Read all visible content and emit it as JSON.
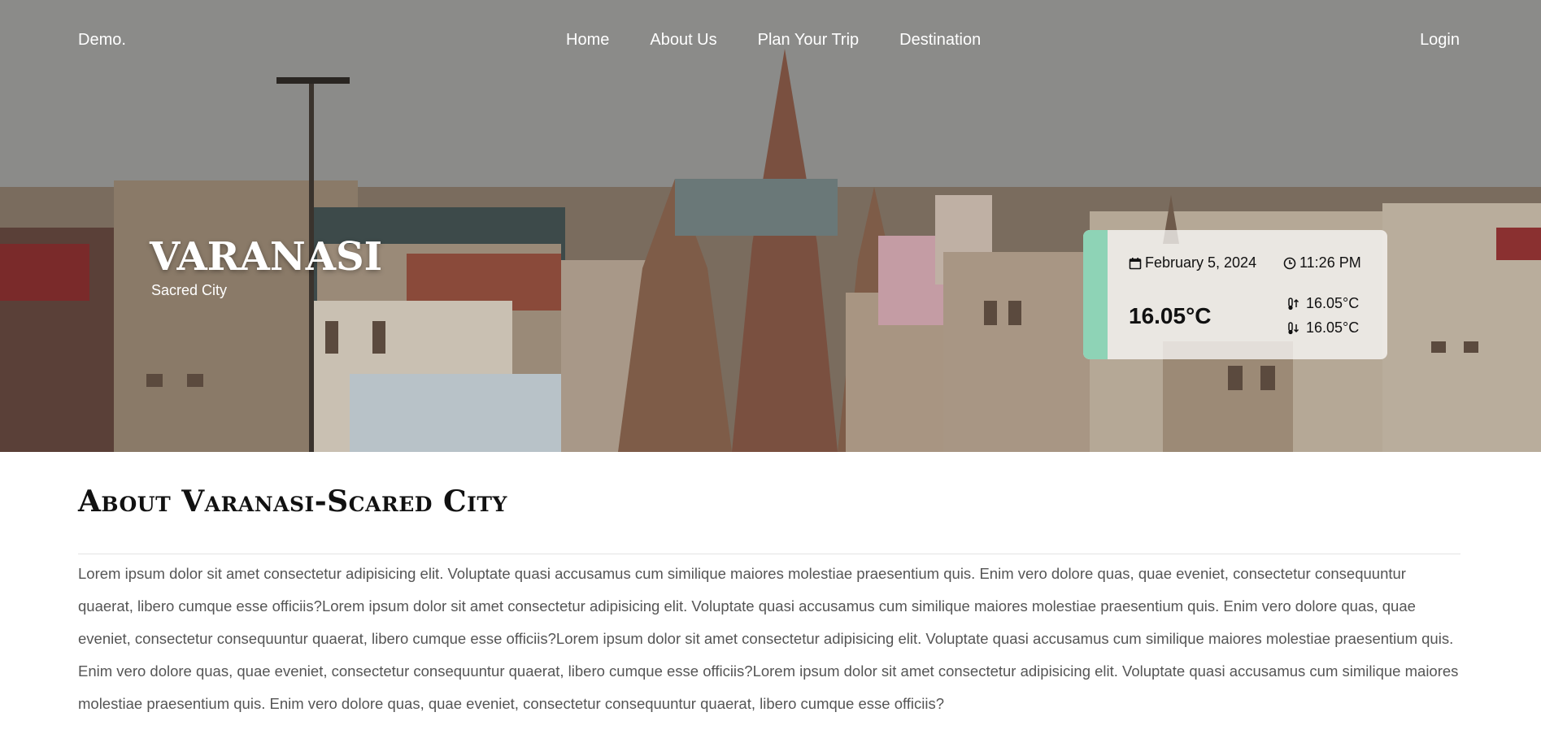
{
  "nav": {
    "brand": "Demo.",
    "links": [
      "Home",
      "About Us",
      "Plan Your Trip",
      "Destination"
    ],
    "login": "Login"
  },
  "hero": {
    "title": "VARANASI",
    "subtitle": "Sacred City"
  },
  "weather": {
    "date": "February 5, 2024",
    "time": "11:26 PM",
    "temp": "16.05°C",
    "max": "16.05°C",
    "min": "16.05°C",
    "accent": "#8ed3b6",
    "icons": [
      "calendar-icon",
      "clock-icon",
      "thermometer-up-icon",
      "thermometer-down-icon"
    ]
  },
  "about": {
    "title": "About Varanasi-Scared City",
    "text": "Lorem ipsum dolor sit amet consectetur adipisicing elit. Voluptate quasi accusamus cum similique maiores molestiae praesentium quis. Enim vero dolore quas, quae eveniet, consectetur consequuntur quaerat, libero cumque esse officiis?Lorem ipsum dolor sit amet consectetur adipisicing elit. Voluptate quasi accusamus cum similique maiores molestiae praesentium quis. Enim vero dolore quas, quae eveniet, consectetur consequuntur quaerat, libero cumque esse officiis?Lorem ipsum dolor sit amet consectetur adipisicing elit. Voluptate quasi accusamus cum similique maiores molestiae praesentium quis. Enim vero dolore quas, quae eveniet, consectetur consequuntur quaerat, libero cumque esse officiis?Lorem ipsum dolor sit amet consectetur adipisicing elit. Voluptate quasi accusamus cum similique maiores molestiae praesentium quis. Enim vero dolore quas, quae eveniet, consectetur consequuntur quaerat, libero cumque esse officiis?"
  }
}
